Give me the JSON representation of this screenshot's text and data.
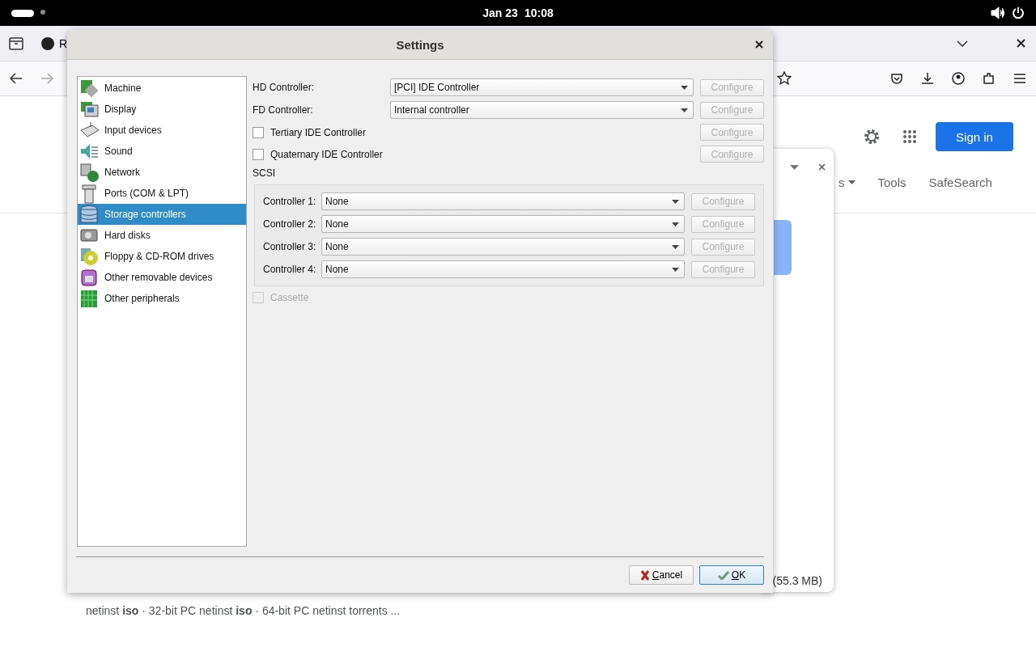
{
  "top_bar": {
    "date": "Jan 23",
    "time": "10:08"
  },
  "browser": {
    "tab_label": "R",
    "sign_in": "Sign in",
    "nav": [
      {
        "label": "s",
        "dropdown": true
      },
      {
        "label": "Tools",
        "dropdown": false
      },
      {
        "label": "SafeSearch",
        "dropdown": false
      }
    ],
    "popup": {
      "size": "(55.3 MB)"
    },
    "snippet": "netinst **iso** · 32-bit PC netinst **iso** · 64-bit PC netinst torrents ..."
  },
  "dialog": {
    "title": "Settings",
    "categories": [
      {
        "label": "Machine",
        "selected": false
      },
      {
        "label": "Display",
        "selected": false
      },
      {
        "label": "Input devices",
        "selected": false
      },
      {
        "label": "Sound",
        "selected": false
      },
      {
        "label": "Network",
        "selected": false
      },
      {
        "label": "Ports (COM & LPT)",
        "selected": false
      },
      {
        "label": "Storage controllers",
        "selected": true
      },
      {
        "label": "Hard disks",
        "selected": false
      },
      {
        "label": "Floppy & CD-ROM drives",
        "selected": false
      },
      {
        "label": "Other removable devices",
        "selected": false
      },
      {
        "label": "Other peripherals",
        "selected": false
      }
    ],
    "controllers": [
      {
        "label": "HD Controller:",
        "value": "[PCI] IDE Controller",
        "configure": "Configure",
        "disabled": true
      },
      {
        "label": "FD Controller:",
        "value": "Internal controller",
        "configure": "Configure",
        "disabled": true
      }
    ],
    "ide_options": [
      {
        "label": "Tertiary IDE Controller",
        "checked": false,
        "configure": "Configure",
        "disabled": true
      },
      {
        "label": "Quaternary IDE Controller",
        "checked": false,
        "configure": "Configure",
        "disabled": true
      }
    ],
    "scsi": {
      "title": "SCSI",
      "controllers": [
        {
          "label": "Controller 1:",
          "value": "None",
          "configure": "Configure",
          "disabled": true
        },
        {
          "label": "Controller 2:",
          "value": "None",
          "configure": "Configure",
          "disabled": true
        },
        {
          "label": "Controller 3:",
          "value": "None",
          "configure": "Configure",
          "disabled": true
        },
        {
          "label": "Controller 4:",
          "value": "None",
          "configure": "Configure",
          "disabled": true
        }
      ]
    },
    "cassette": {
      "label": "Cassette",
      "checked": false,
      "disabled": true
    },
    "buttons": [
      {
        "label": "Cancel",
        "kind": "cancel",
        "default": false
      },
      {
        "label": "OK",
        "kind": "ok",
        "default": true
      }
    ]
  }
}
